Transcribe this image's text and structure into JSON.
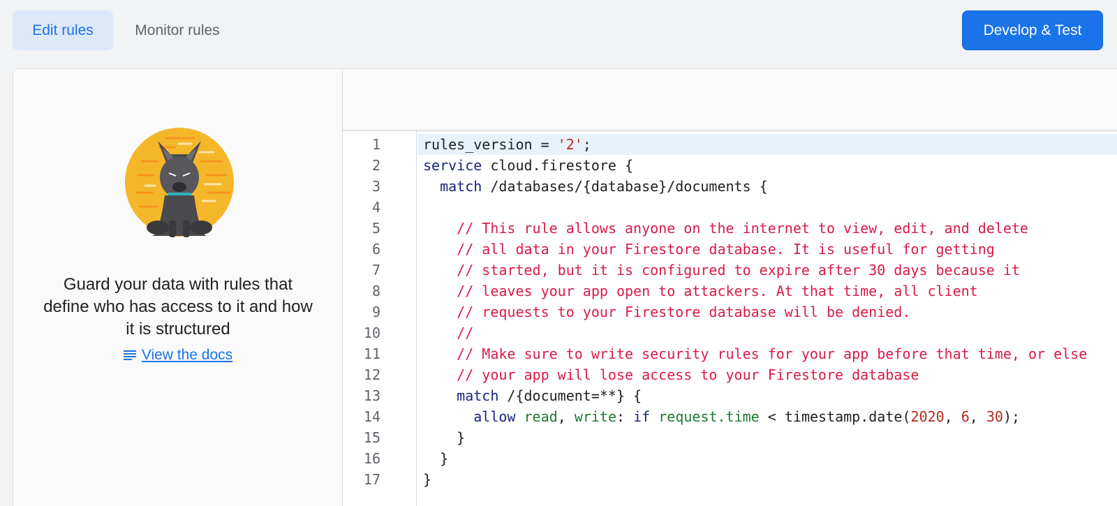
{
  "tabs": {
    "edit_rules": "Edit rules",
    "monitor_rules": "Monitor rules"
  },
  "develop_button": "Develop & Test",
  "left_panel": {
    "mascot_icon": "firebase-dog-mascot-icon",
    "description": "Guard your data with rules that define who has access to it and how it is structured",
    "docs_link": "View the docs",
    "docs_icon": "notes-icon"
  },
  "editor": {
    "line_numbers": [
      "1",
      "2",
      "3",
      "4",
      "5",
      "6",
      "7",
      "8",
      "9",
      "10",
      "11",
      "12",
      "13",
      "14",
      "15",
      "16",
      "17"
    ],
    "lines": [
      "rules_version = '2';",
      "service cloud.firestore {",
      "  match /databases/{database}/documents {",
      "",
      "    // This rule allows anyone on the internet to view, edit, and delete",
      "    // all data in your Firestore database. It is useful for getting",
      "    // started, but it is configured to expire after 30 days because it",
      "    // leaves your app open to attackers. At that time, all client",
      "    // requests to your Firestore database will be denied.",
      "    //",
      "    // Make sure to write security rules for your app before that time, or else",
      "    // your app will lose access to your Firestore database",
      "    match /{document=**} {",
      "      allow read, write: if request.time < timestamp.date(2020, 6, 30);",
      "    }",
      "  }",
      "}"
    ]
  },
  "colors": {
    "accent": "#1a73e8",
    "comment": "#d81b47",
    "keyword": "#1a237e"
  }
}
